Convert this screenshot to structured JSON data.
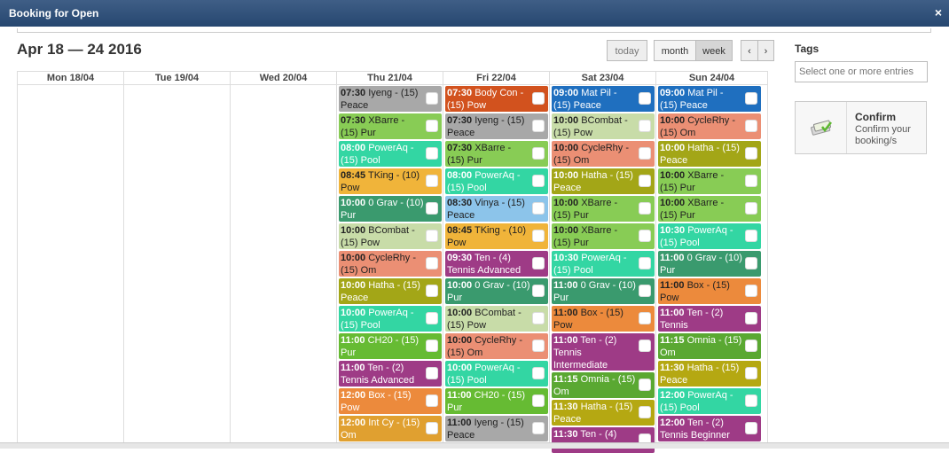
{
  "window": {
    "title": "Booking for Open",
    "close": "×"
  },
  "calendar": {
    "range": "Apr 18 — 24 2016",
    "buttons": {
      "today": "today",
      "month": "month",
      "week": "week",
      "prev": "‹",
      "next": "›"
    },
    "days": [
      {
        "label": "Mon 18/04",
        "events": []
      },
      {
        "label": "Tue 19/04",
        "events": []
      },
      {
        "label": "Wed 20/04",
        "events": []
      },
      {
        "label": "Thu 21/04",
        "events": [
          {
            "time": "07:30",
            "text": "Iyeng - (15) Peace",
            "color": "#a8a8a8"
          },
          {
            "time": "07:30",
            "text": "XBarre - (15) Pur",
            "color": "#88cc55"
          },
          {
            "time": "08:00",
            "text": "PowerAq - (15) Pool",
            "color": "#33d6a3",
            "light": true
          },
          {
            "time": "08:45",
            "text": "TKing - (10) Pow",
            "color": "#f0b43a"
          },
          {
            "time": "10:00",
            "text": "0 Grav - (10) Pur",
            "color": "#3a9a6e",
            "light": true
          },
          {
            "time": "10:00",
            "text": "BCombat - (15) Pow",
            "color": "#c8dca8"
          },
          {
            "time": "10:00",
            "text": "CycleRhy - (15) Om",
            "color": "#eb8f74"
          },
          {
            "time": "10:00",
            "text": "Hatha - (15) Peace",
            "color": "#a3a617",
            "light": true
          },
          {
            "time": "10:00",
            "text": "PowerAq - (15) Pool",
            "color": "#33d6a3",
            "light": true
          },
          {
            "time": "11:00",
            "text": "CH20 - (15) Pur",
            "color": "#66bb33",
            "light": true
          },
          {
            "time": "11:00",
            "text": "Ten - (2) Tennis Advanced",
            "color": "#9e3b86",
            "light": true
          },
          {
            "time": "12:00",
            "text": "Box - (15) Pow",
            "color": "#ec8a3c",
            "light": true
          },
          {
            "time": "12:00",
            "text": "Int Cy - (15) Om",
            "color": "#e0a030",
            "light": true
          }
        ]
      },
      {
        "label": "Fri 22/04",
        "events": [
          {
            "time": "07:30",
            "text": "Body Con - (15) Pow",
            "color": "#d2521e",
            "light": true
          },
          {
            "time": "07:30",
            "text": "Iyeng - (15) Peace",
            "color": "#a8a8a8"
          },
          {
            "time": "07:30",
            "text": "XBarre - (15) Pur",
            "color": "#88cc55"
          },
          {
            "time": "08:00",
            "text": "PowerAq - (15) Pool",
            "color": "#33d6a3",
            "light": true
          },
          {
            "time": "08:30",
            "text": "Vinya - (15) Peace",
            "color": "#8cc4ea"
          },
          {
            "time": "08:45",
            "text": "TKing - (10) Pow",
            "color": "#f0b43a"
          },
          {
            "time": "09:30",
            "text": "Ten - (4) Tennis Advanced",
            "color": "#9e3b86",
            "light": true
          },
          {
            "time": "10:00",
            "text": "0 Grav - (10) Pur",
            "color": "#3a9a6e",
            "light": true
          },
          {
            "time": "10:00",
            "text": "BCombat - (15) Pow",
            "color": "#c8dca8"
          },
          {
            "time": "10:00",
            "text": "CycleRhy - (15) Om",
            "color": "#eb8f74"
          },
          {
            "time": "10:00",
            "text": "PowerAq - (15) Pool",
            "color": "#33d6a3",
            "light": true
          },
          {
            "time": "11:00",
            "text": "CH20 - (15) Pur",
            "color": "#66bb33",
            "light": true
          },
          {
            "time": "11:00",
            "text": "Iyeng - (15) Peace",
            "color": "#a8a8a8"
          }
        ]
      },
      {
        "label": "Sat 23/04",
        "events": [
          {
            "time": "09:00",
            "text": "Mat Pil - (15) Peace",
            "color": "#1f6fbf",
            "light": true
          },
          {
            "time": "10:00",
            "text": "BCombat - (15) Pow",
            "color": "#c8dca8"
          },
          {
            "time": "10:00",
            "text": "CycleRhy - (15) Om",
            "color": "#eb8f74"
          },
          {
            "time": "10:00",
            "text": "Hatha - (15) Peace",
            "color": "#a3a617",
            "light": true
          },
          {
            "time": "10:00",
            "text": "XBarre - (15) Pur",
            "color": "#88cc55"
          },
          {
            "time": "10:00",
            "text": "XBarre - (15) Pur",
            "color": "#88cc55"
          },
          {
            "time": "10:30",
            "text": "PowerAq - (15) Pool",
            "color": "#33d6a3",
            "light": true
          },
          {
            "time": "11:00",
            "text": "0 Grav - (10) Pur",
            "color": "#3a9a6e",
            "light": true
          },
          {
            "time": "11:00",
            "text": "Box - (15) Pow",
            "color": "#ec8a3c"
          },
          {
            "time": "11:00",
            "text": "Ten - (2) Tennis Intermediate",
            "color": "#9e3b86",
            "light": true,
            "tall": true
          },
          {
            "time": "11:15",
            "text": "Omnia - (15) Om",
            "color": "#5aa832",
            "light": true
          },
          {
            "time": "11:30",
            "text": "Hatha - (15) Peace",
            "color": "#b5a812",
            "light": true
          },
          {
            "time": "11:30",
            "text": "Ten - (4)",
            "color": "#9e3b86",
            "light": true
          }
        ]
      },
      {
        "label": "Sun 24/04",
        "events": [
          {
            "time": "09:00",
            "text": "Mat Pil - (15) Peace",
            "color": "#1f6fbf",
            "light": true
          },
          {
            "time": "10:00",
            "text": "CycleRhy - (15) Om",
            "color": "#eb8f74"
          },
          {
            "time": "10:00",
            "text": "Hatha - (15) Peace",
            "color": "#a3a617",
            "light": true
          },
          {
            "time": "10:00",
            "text": "XBarre - (15) Pur",
            "color": "#88cc55"
          },
          {
            "time": "10:00",
            "text": "XBarre - (15) Pur",
            "color": "#88cc55"
          },
          {
            "time": "10:30",
            "text": "PowerAq - (15) Pool",
            "color": "#33d6a3",
            "light": true
          },
          {
            "time": "11:00",
            "text": "0 Grav - (10) Pur",
            "color": "#3a9a6e",
            "light": true
          },
          {
            "time": "11:00",
            "text": "Box - (15) Pow",
            "color": "#ec8a3c"
          },
          {
            "time": "11:00",
            "text": "Ten - (2) Tennis Intermediate",
            "color": "#9e3b86",
            "light": true
          },
          {
            "time": "11:15",
            "text": "Omnia - (15) Om",
            "color": "#5aa832",
            "light": true
          },
          {
            "time": "11:30",
            "text": "Hatha - (15) Peace",
            "color": "#b5a812",
            "light": true
          },
          {
            "time": "12:00",
            "text": "PowerAq - (15) Pool",
            "color": "#33d6a3",
            "light": true
          },
          {
            "time": "12:00",
            "text": "Ten - (2) Tennis Beginner",
            "color": "#9e3b86",
            "light": true
          }
        ]
      }
    ]
  },
  "tags": {
    "label": "Tags",
    "placeholder": "Select one or more entries"
  },
  "confirm": {
    "title": "Confirm",
    "subtitle": "Confirm your booking/s",
    "icon": "booking-confirm-icon"
  }
}
